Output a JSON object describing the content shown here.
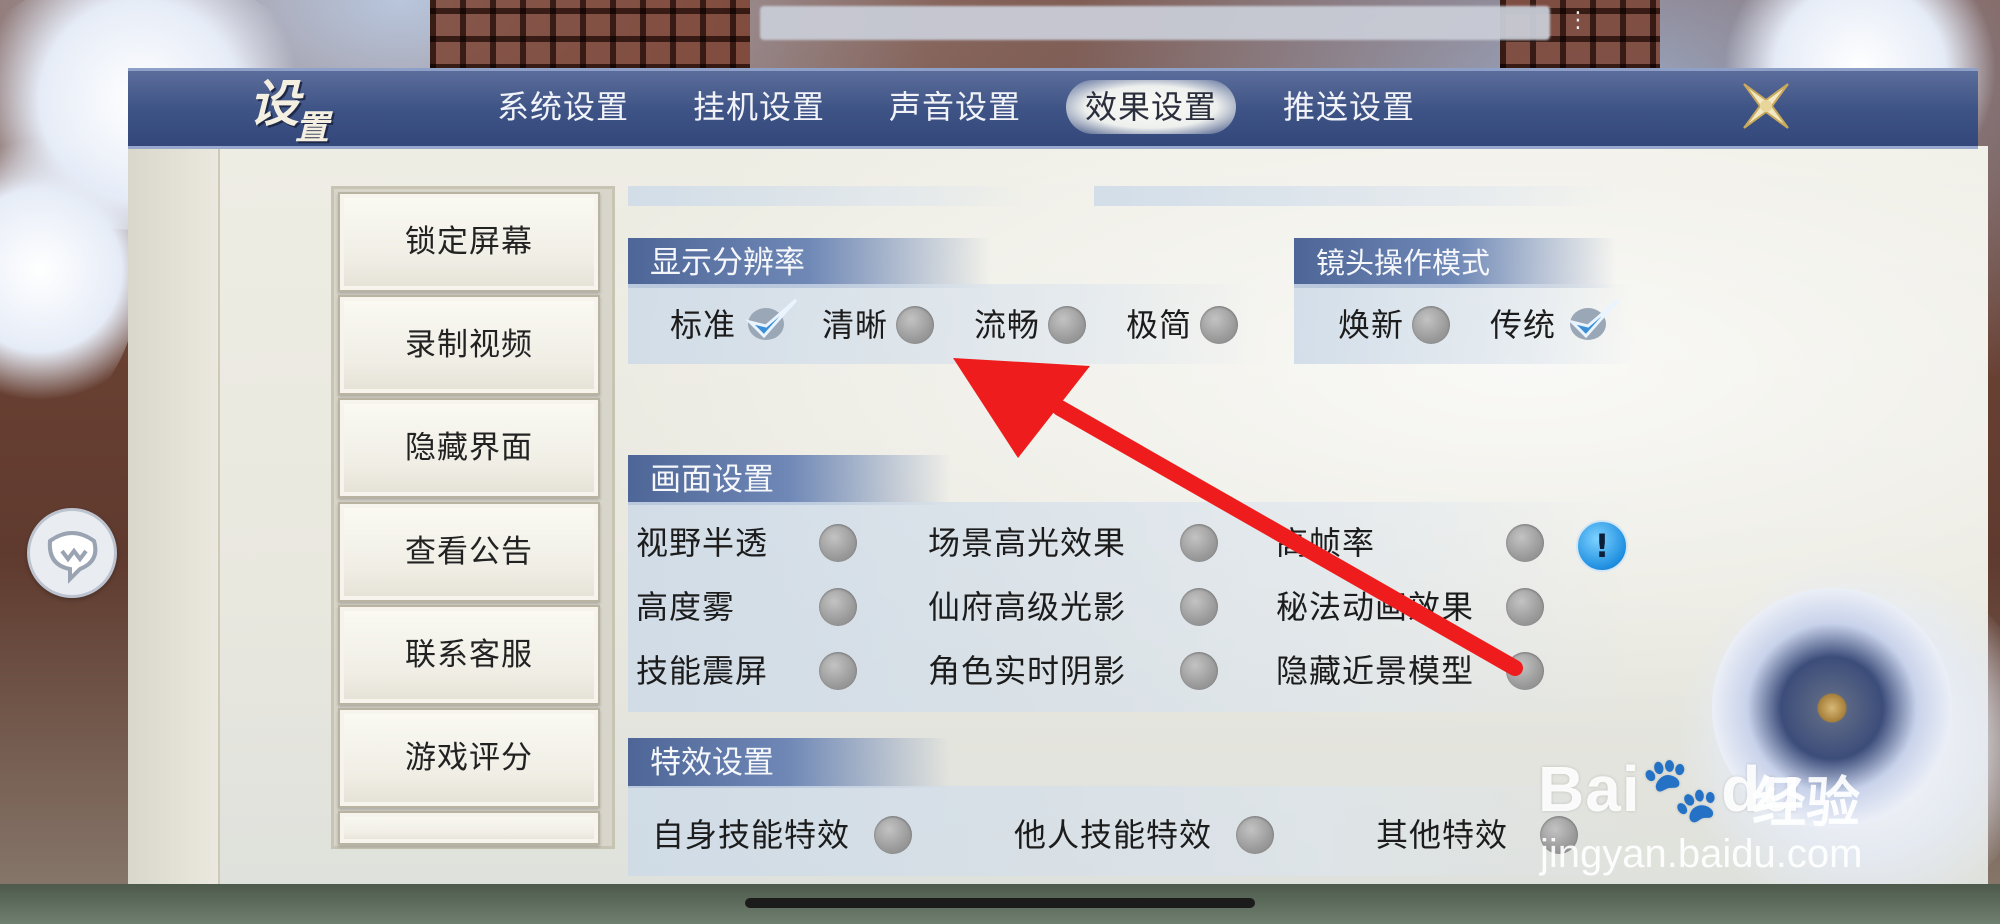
{
  "header": {
    "title_char1": "设",
    "title_char2": "置",
    "tabs": [
      {
        "label": "系统设置",
        "active": false
      },
      {
        "label": "挂机设置",
        "active": false
      },
      {
        "label": "声音设置",
        "active": false
      },
      {
        "label": "效果设置",
        "active": true
      },
      {
        "label": "推送设置",
        "active": false
      }
    ],
    "close_icon": "close-x-icon"
  },
  "sidebar": {
    "buttons": [
      "锁定屏幕",
      "录制视频",
      "隐藏界面",
      "查看公告",
      "联系客服",
      "游戏评分"
    ]
  },
  "resolution": {
    "title": "显示分辨率",
    "options": [
      {
        "label": "标准",
        "selected": true
      },
      {
        "label": "清晰",
        "selected": false
      },
      {
        "label": "流畅",
        "selected": false
      },
      {
        "label": "极简",
        "selected": false
      }
    ]
  },
  "camera": {
    "title": "镜头操作模式",
    "options": [
      {
        "label": "焕新",
        "selected": false
      },
      {
        "label": "传统",
        "selected": true
      }
    ]
  },
  "picture": {
    "title": "画面设置",
    "options": [
      {
        "label": "视野半透",
        "checked": false
      },
      {
        "label": "场景高光效果",
        "checked": false
      },
      {
        "label": "高帧率",
        "checked": false
      },
      {
        "label": "高度雾",
        "checked": false
      },
      {
        "label": "仙府高级光影",
        "checked": false
      },
      {
        "label": "秘法动画效果",
        "checked": false
      },
      {
        "label": "技能震屏",
        "checked": false
      },
      {
        "label": "角色实时阴影",
        "checked": false
      },
      {
        "label": "隐藏近景模型",
        "checked": false
      }
    ],
    "info_label": "!"
  },
  "effects": {
    "title": "特效设置",
    "options": [
      {
        "label": "自身技能特效",
        "checked": false
      },
      {
        "label": "他人技能特效",
        "checked": false
      },
      {
        "label": "其他特效",
        "checked": false
      }
    ]
  },
  "watermark": {
    "brand": "Bai",
    "brand2": "du",
    "cn": "经验",
    "url": "jingyan.baidu.com"
  },
  "colors": {
    "header_blue": "#3f5486",
    "section_blue": "#4d6697",
    "annotation_red": "#ee1c1c",
    "check_blue": "#3a8fd8"
  }
}
